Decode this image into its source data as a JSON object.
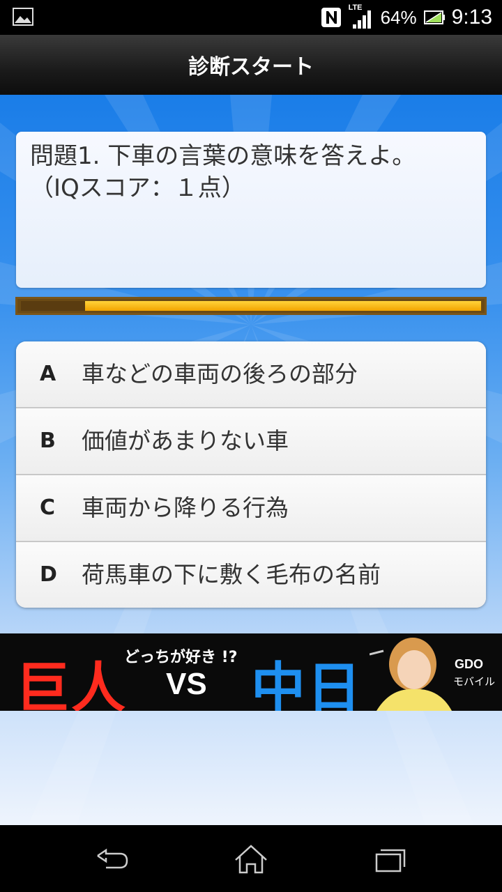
{
  "status_bar": {
    "battery_percent": "64%",
    "time": "9:13",
    "network": "LTE",
    "icons": [
      "gallery-icon",
      "nfc-icon",
      "signal-icon",
      "battery-icon"
    ]
  },
  "action_bar": {
    "title": "診断スタート"
  },
  "question": {
    "text": "問題1. 下車の言葉の意味を答えよ。（IQスコア：１点）",
    "progress_fraction": 0.14
  },
  "choices": [
    {
      "letter": "A",
      "text": "車などの車両の後ろの部分"
    },
    {
      "letter": "B",
      "text": "価値があまりない車"
    },
    {
      "letter": "C",
      "text": "車両から降りる行為"
    },
    {
      "letter": "D",
      "text": "荷馬車の下に敷く毛布の名前"
    }
  ],
  "ad": {
    "left_text": "巨人",
    "tagline": "どっちが好き !?",
    "vs": "VS",
    "right_text": "中日",
    "brand": "GDO",
    "brand_sub": "モバイル"
  },
  "colors": {
    "accent_blue": "#1a7de8",
    "progress_fill": "#f2a300",
    "ad_red": "#ff2b1e",
    "ad_blue": "#1e8ff0"
  }
}
